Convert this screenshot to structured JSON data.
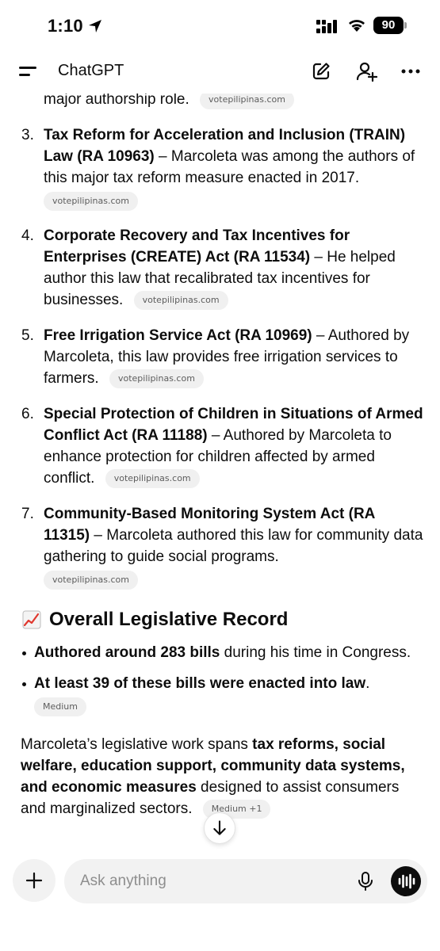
{
  "status_bar": {
    "time": "1:10",
    "battery": "90"
  },
  "header": {
    "title": "ChatGPT"
  },
  "content": {
    "continuation_text": "major authorship role.",
    "continuation_source": "votepilipinas.com",
    "laws": [
      {
        "num": "3.",
        "title": "Tax Reform for Acceleration and Inclusion (TRAIN) Law (RA 10963)",
        "desc": " – Marcoleta was among the authors of this major tax reform measure enacted in 2017.",
        "source": "votepilipinas.com"
      },
      {
        "num": "4.",
        "title": "Corporate Recovery and Tax Incentives for Enterprises (CREATE) Act (RA 11534)",
        "desc": " – He helped author this law that recalibrated tax incentives for businesses.",
        "source": "votepilipinas.com"
      },
      {
        "num": "5.",
        "title": "Free Irrigation Service Act (RA 10969)",
        "desc": " – Authored by Marcoleta, this law provides free irrigation services to farmers.",
        "source": "votepilipinas.com"
      },
      {
        "num": "6.",
        "title": "Special Protection of Children in Situations of Armed Conflict Act (RA 11188)",
        "desc": " – Authored by Marcoleta to enhance protection for children affected by armed conflict.",
        "source": "votepilipinas.com"
      },
      {
        "num": "7.",
        "title": "Community-Based Monitoring System Act (RA 11315)",
        "desc": " – Marcoleta authored this law for community data gathering to guide social programs.",
        "source": "votepilipinas.com"
      }
    ],
    "section_heading": "Overall Legislative Record",
    "bullets": [
      {
        "bold": "Authored around 283 bills",
        "rest": " during his time in Congress.",
        "source": ""
      },
      {
        "bold": "At least 39 of these bills were enacted into law",
        "rest": ".",
        "source": "Medium"
      }
    ],
    "summary": {
      "pre": "Marcoleta’s legislative work spans ",
      "bold": "tax reforms, social welfare, education support, community data systems, and economic measures",
      "post": " designed to assist consumers and marginalized sectors.",
      "source": "Medium +1"
    }
  },
  "composer": {
    "placeholder": "Ask anything"
  },
  "icons": {
    "menu": "menu-icon",
    "new_chat": "edit-icon",
    "add_person": "add-person-icon",
    "more": "more-icon",
    "scroll_down": "arrow-down-icon",
    "plus": "plus-icon",
    "mic": "mic-icon",
    "voice": "voice-waveform-icon"
  }
}
